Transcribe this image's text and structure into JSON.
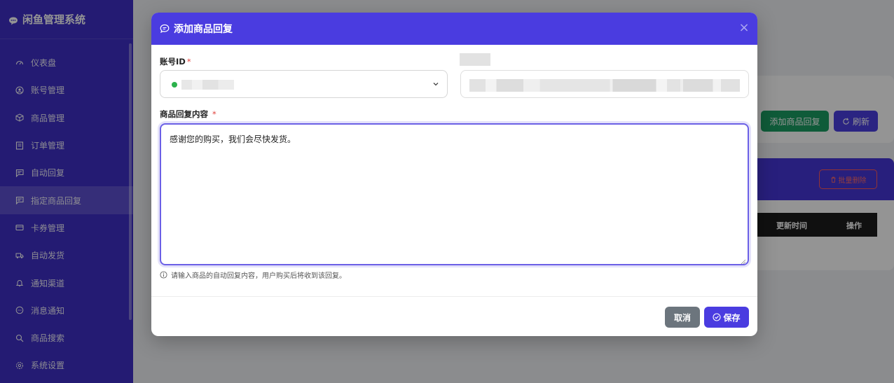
{
  "app": {
    "brand": "闲鱼管理系统"
  },
  "sidebar": {
    "items": [
      {
        "label": "仪表盘",
        "icon": "dashboard-icon"
      },
      {
        "label": "账号管理",
        "icon": "user-icon"
      },
      {
        "label": "商品管理",
        "icon": "box-icon"
      },
      {
        "label": "订单管理",
        "icon": "order-icon"
      },
      {
        "label": "自动回复",
        "icon": "chat-icon"
      },
      {
        "label": "指定商品回复",
        "icon": "chat-icon",
        "active": true
      },
      {
        "label": "卡券管理",
        "icon": "card-icon"
      },
      {
        "label": "自动发货",
        "icon": "truck-icon"
      },
      {
        "label": "通知渠道",
        "icon": "bell-icon"
      },
      {
        "label": "消息通知",
        "icon": "message-icon"
      },
      {
        "label": "商品搜索",
        "icon": "search-icon"
      },
      {
        "label": "系统设置",
        "icon": "gear-icon"
      }
    ]
  },
  "background": {
    "add_reply_label": "添加商品回复",
    "refresh_label": "刷新",
    "batch_delete_label": "批量删除",
    "table_headers": {
      "update_time": "更新时间",
      "actions": "操作"
    }
  },
  "modal": {
    "title": "添加商品回复",
    "account_label": "账号ID",
    "required_mark": "*",
    "content_label": "商品回复内容",
    "content_value": "感谢您的购买，我们会尽快发货。",
    "hint": "请输入商品的自动回复内容，用户购买后将收到该回复。",
    "cancel_label": "取消",
    "save_label": "保存"
  },
  "colors": {
    "sidebar": "#3e2fc7",
    "accent": "#4a3ce0",
    "success": "#1a9d62",
    "cancel": "#6c757d",
    "danger": "#e0423c"
  }
}
